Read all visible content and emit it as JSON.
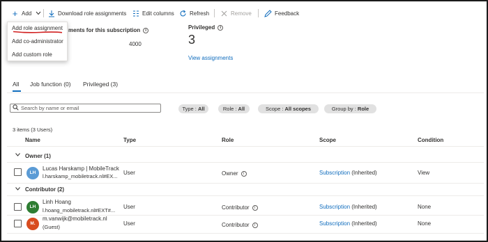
{
  "toolbar": {
    "add": "Add",
    "download": "Download role assignments",
    "edit_columns": "Edit columns",
    "refresh": "Refresh",
    "remove": "Remove",
    "feedback": "Feedback"
  },
  "add_menu": {
    "items": [
      "Add role assignment",
      "Add co-administrator",
      "Add custom role"
    ]
  },
  "summary": {
    "role_assignments_title": "ments for this subscription",
    "role_assignments_value": "4000",
    "privileged_title": "Privileged",
    "privileged_count": "3",
    "view_assignments": "View assignments"
  },
  "tabs": [
    "All",
    "Job function (0)",
    "Privileged (3)"
  ],
  "filters": {
    "search_placeholder": "Search by name or email",
    "type_label": "Type : ",
    "type_value": "All",
    "role_label": "Role : ",
    "role_value": "All",
    "scope_label": "Scope : ",
    "scope_value": "All scopes",
    "group_label": "Group by : ",
    "group_value": "Role"
  },
  "items_count": "3 items (3 Users)",
  "columns": [
    "Name",
    "Type",
    "Role",
    "Scope",
    "Condition"
  ],
  "groups": [
    {
      "label": "Owner (1)",
      "rows": [
        {
          "initials": "LH",
          "avatar_color": "#5b9bd5",
          "name": "Lucas Harskamp | MobileTrack",
          "email": "l.harskamp_mobiletrack.nl#EX...",
          "type": "User",
          "role": "Owner",
          "scope_link": "Subscription",
          "scope_note": " (Inherited)",
          "condition": "View"
        }
      ]
    },
    {
      "label": "Contributor (2)",
      "rows": [
        {
          "initials": "LH",
          "avatar_color": "#2e7d32",
          "name": "Linh Hoang",
          "email": "l.hoang_mobiletrack.nl#EXT#...",
          "type": "User",
          "role": "Contributor",
          "scope_link": "Subscription",
          "scope_note": " (Inherited)",
          "condition": "None"
        },
        {
          "initials": "M.",
          "avatar_color": "#d84c1f",
          "name": "m.vanwijk@mobiletrack.nl",
          "email": "(Guest)",
          "type": "User",
          "role": "Contributor",
          "scope_link": "Subscription",
          "scope_note": " (Inherited)",
          "condition": "None"
        }
      ]
    }
  ],
  "colors": {
    "accent": "#0f6cbd",
    "annotation_red": "#d11f1f"
  }
}
